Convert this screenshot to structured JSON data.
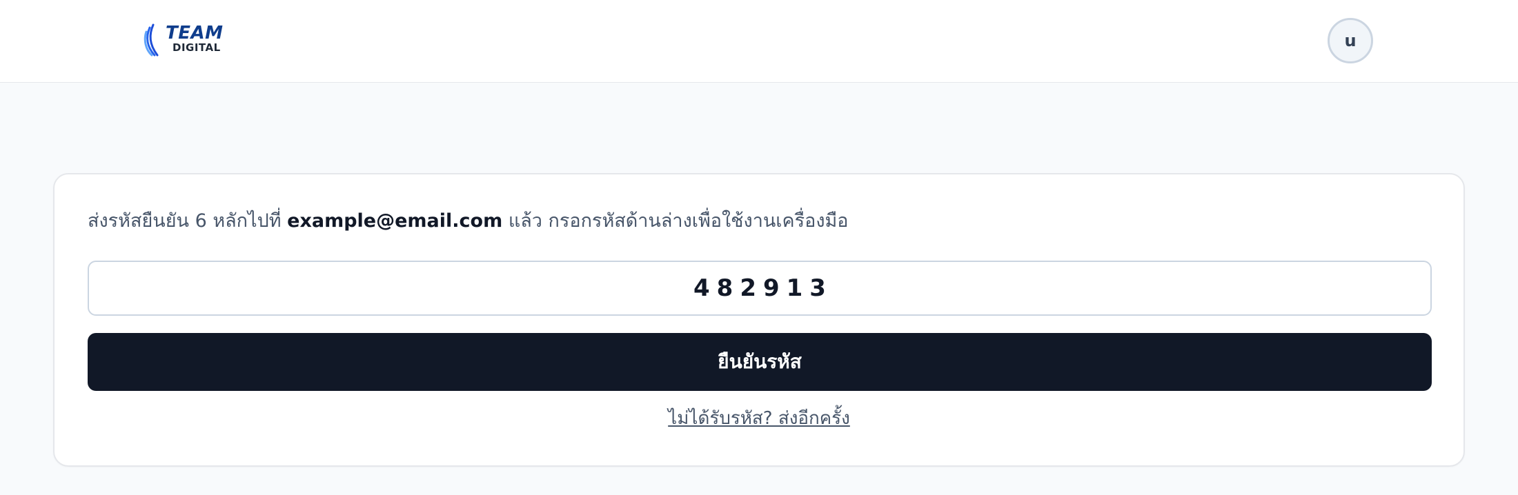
{
  "header": {
    "logo": {
      "line1": "TEAM",
      "line2": "DIGITAL"
    },
    "avatar_initial": "u"
  },
  "verify": {
    "instruction_prefix": "ส่งรหัสยืนยัน 6 หลักไปที่ ",
    "email": "example@email.com",
    "instruction_suffix": " แล้ว กรอกรหัสด้านล่างเพื่อใช้งานเครื่องมือ",
    "code_value": "482913",
    "submit_label": "ยืนยันรหัส",
    "resend_label": "ไม่ได้รับรหัส? ส่งอีกครั้ง"
  },
  "colors": {
    "page_background": "#f8fafc",
    "primary_button": "#111827",
    "brand_blue": "#0f3d8c",
    "link": "#475569"
  }
}
